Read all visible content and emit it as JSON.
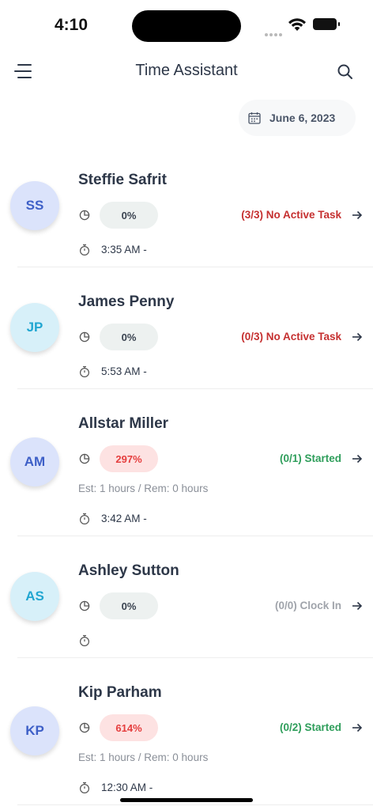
{
  "status_bar": {
    "time": "4:10"
  },
  "header": {
    "title": "Time Assistant"
  },
  "date_filter": {
    "label": "June 6, 2023"
  },
  "colors": {
    "status_red": "#c53030",
    "status_green": "#2f9e5b",
    "status_gray": "#a0a4ab",
    "pill_neutral_bg": "#edf1f0",
    "pill_danger_bg": "#fde2e2",
    "pill_danger_text": "#e53e3e"
  },
  "employees": [
    {
      "initials": "SS",
      "name": "Steffie Safrit",
      "percent": "0%",
      "status": "(3/3) No Active Task",
      "status_color": "#c53030",
      "pill_bg": "#edf1f0",
      "pill_text": "#3a4350",
      "avatar_bg": "#dbe3fb",
      "avatar_text": "#3d5fc7",
      "est": "",
      "time": "3:35 AM -"
    },
    {
      "initials": "JP",
      "name": "James Penny",
      "percent": "0%",
      "status": "(0/3) No Active Task",
      "status_color": "#c53030",
      "pill_bg": "#edf1f0",
      "pill_text": "#3a4350",
      "avatar_bg": "#d7f0f9",
      "avatar_text": "#21a6d1",
      "est": "",
      "time": "5:53 AM -"
    },
    {
      "initials": "AM",
      "name": "Allstar Miller",
      "percent": "297%",
      "status": "(0/1) Started",
      "status_color": "#2f9e5b",
      "pill_bg": "#fde2e2",
      "pill_text": "#e53e3e",
      "avatar_bg": "#dbe3fb",
      "avatar_text": "#3d5fc7",
      "est": "Est: 1 hours  / Rem: 0 hours",
      "time": "3:42 AM -"
    },
    {
      "initials": "AS",
      "name": "Ashley Sutton",
      "percent": "0%",
      "status": "(0/0) Clock In",
      "status_color": "#a0a4ab",
      "pill_bg": "#edf1f0",
      "pill_text": "#3a4350",
      "avatar_bg": "#d7f0f9",
      "avatar_text": "#21a6d1",
      "est": "",
      "time": ""
    },
    {
      "initials": "KP",
      "name": "Kip Parham",
      "percent": "614%",
      "status": "(0/2) Started",
      "status_color": "#2f9e5b",
      "pill_bg": "#fde2e2",
      "pill_text": "#e53e3e",
      "avatar_bg": "#dbe3fb",
      "avatar_text": "#3d5fc7",
      "est": "Est: 1 hours  / Rem: 0 hours",
      "time": "12:30 AM -"
    }
  ]
}
